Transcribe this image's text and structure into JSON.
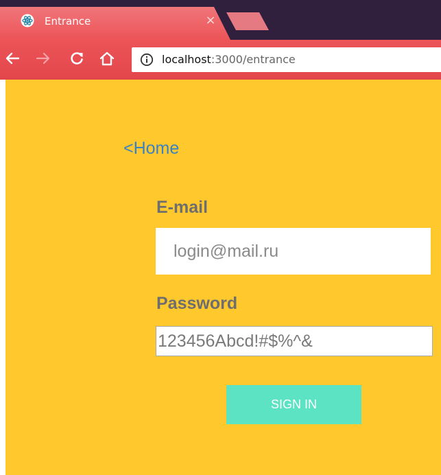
{
  "browser": {
    "tab": {
      "title": "Entrance",
      "close_glyph": "×",
      "favicon": "electron-icon"
    },
    "toolbar": {
      "url_host": "localhost",
      "url_path": ":3000/entrance",
      "icons": [
        "back-arrow-icon",
        "forward-arrow-icon",
        "reload-icon",
        "home-icon",
        "info-icon"
      ]
    },
    "colors": {
      "tabstrip": "#311f3e",
      "toolbar": "#ec5458",
      "new_tab": "#e57a83"
    }
  },
  "page": {
    "background": "#ffc82c",
    "home_link": "<Home",
    "email": {
      "label": "E-mail",
      "placeholder": "login@mail.ru"
    },
    "password": {
      "label": "Password",
      "value": "123456Abcd!#$%^&"
    },
    "signin": {
      "label": "SIGN IN",
      "color": "#5be3c3"
    }
  }
}
